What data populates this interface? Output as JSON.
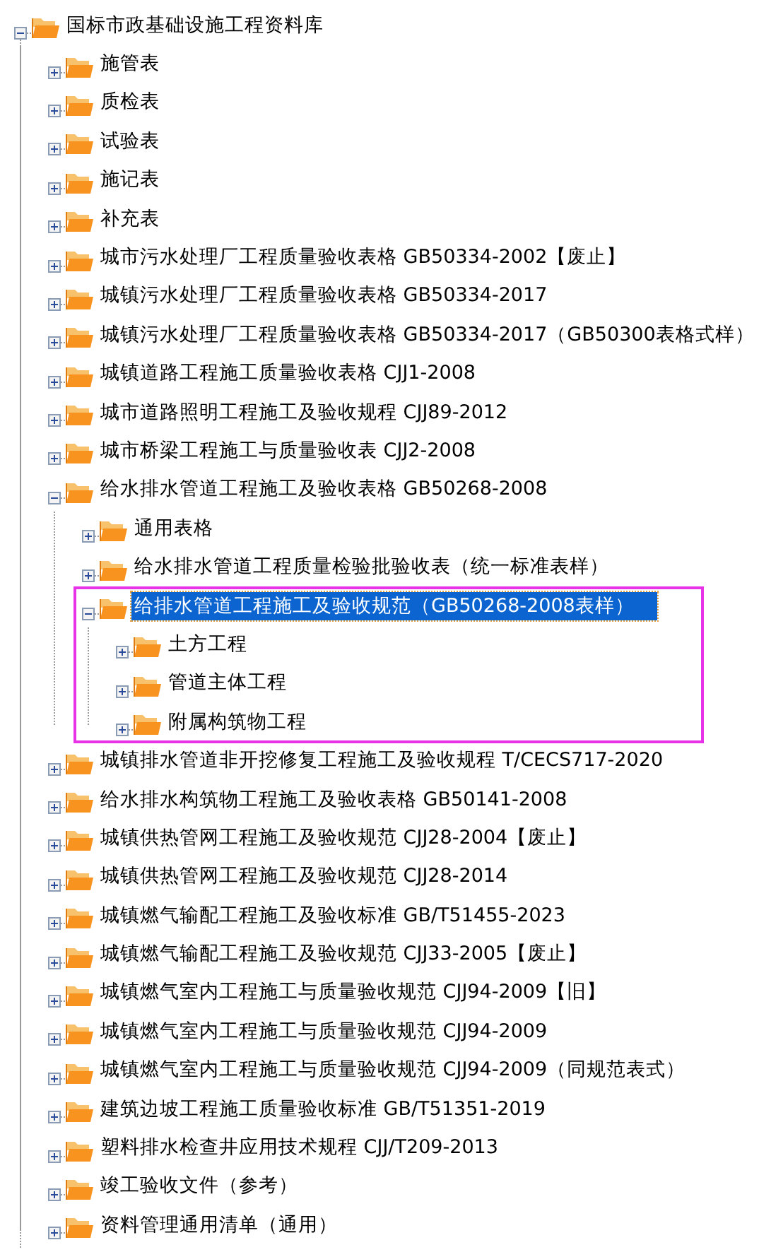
{
  "tree": [
    {
      "label": "国标市政基础设施工程资料库",
      "expanded": true,
      "selected": false,
      "highlighted": false,
      "children": [
        {
          "label": "施管表",
          "expanded": false,
          "selected": false,
          "highlighted": false
        },
        {
          "label": "质检表",
          "expanded": false,
          "selected": false,
          "highlighted": false
        },
        {
          "label": "试验表",
          "expanded": false,
          "selected": false,
          "highlighted": false
        },
        {
          "label": "施记表",
          "expanded": false,
          "selected": false,
          "highlighted": false
        },
        {
          "label": "补充表",
          "expanded": false,
          "selected": false,
          "highlighted": false
        },
        {
          "label": "城市污水处理厂工程质量验收表格 GB50334-2002【废止】",
          "expanded": false,
          "selected": false,
          "highlighted": false
        },
        {
          "label": "城镇污水处理厂工程质量验收表格 GB50334-2017",
          "expanded": false,
          "selected": false,
          "highlighted": false
        },
        {
          "label": "城镇污水处理厂工程质量验收表格 GB50334-2017（GB50300表格式样）",
          "expanded": false,
          "selected": false,
          "highlighted": false
        },
        {
          "label": "城镇道路工程施工质量验收表格 CJJ1-2008",
          "expanded": false,
          "selected": false,
          "highlighted": false
        },
        {
          "label": "城市道路照明工程施工及验收规程 CJJ89-2012",
          "expanded": false,
          "selected": false,
          "highlighted": false
        },
        {
          "label": "城市桥梁工程施工与质量验收表 CJJ2-2008",
          "expanded": false,
          "selected": false,
          "highlighted": false
        },
        {
          "label": "给水排水管道工程施工及验收表格 GB50268-2008",
          "expanded": true,
          "selected": false,
          "highlighted": false,
          "children": [
            {
              "label": "通用表格",
              "expanded": false,
              "selected": false,
              "highlighted": false
            },
            {
              "label": "给水排水管道工程质量检验批验收表（统一标准表样）",
              "expanded": false,
              "selected": false,
              "highlighted": false
            },
            {
              "label": "给排水管道工程施工及验收规范（GB50268-2008表样）",
              "expanded": true,
              "selected": true,
              "highlighted": true,
              "children": [
                {
                  "label": "土方工程",
                  "expanded": false,
                  "selected": false,
                  "highlighted": false
                },
                {
                  "label": "管道主体工程",
                  "expanded": false,
                  "selected": false,
                  "highlighted": false
                },
                {
                  "label": "附属构筑物工程",
                  "expanded": false,
                  "selected": false,
                  "highlighted": false
                }
              ]
            }
          ]
        },
        {
          "label": "城镇排水管道非开挖修复工程施工及验收规程 T/CECS717-2020",
          "expanded": false,
          "selected": false,
          "highlighted": false
        },
        {
          "label": "给水排水构筑物工程施工及验收表格 GB50141-2008",
          "expanded": false,
          "selected": false,
          "highlighted": false
        },
        {
          "label": "城镇供热管网工程施工及验收规范 CJJ28-2004【废止】",
          "expanded": false,
          "selected": false,
          "highlighted": false
        },
        {
          "label": "城镇供热管网工程施工及验收规范 CJJ28-2014",
          "expanded": false,
          "selected": false,
          "highlighted": false
        },
        {
          "label": "城镇燃气输配工程施工及验收标准 GB/T51455-2023",
          "expanded": false,
          "selected": false,
          "highlighted": false
        },
        {
          "label": "城镇燃气输配工程施工及验收规范 CJJ33-2005【废止】",
          "expanded": false,
          "selected": false,
          "highlighted": false
        },
        {
          "label": "城镇燃气室内工程施工与质量验收规范 CJJ94-2009【旧】",
          "expanded": false,
          "selected": false,
          "highlighted": false
        },
        {
          "label": "城镇燃气室内工程施工与质量验收规范 CJJ94-2009",
          "expanded": false,
          "selected": false,
          "highlighted": false
        },
        {
          "label": "城镇燃气室内工程施工与质量验收规范 CJJ94-2009（同规范表式）",
          "expanded": false,
          "selected": false,
          "highlighted": false
        },
        {
          "label": "建筑边坡工程施工质量验收标准 GB/T51351-2019",
          "expanded": false,
          "selected": false,
          "highlighted": false
        },
        {
          "label": "塑料排水检查井应用技术规程 CJJ/T209-2013",
          "expanded": false,
          "selected": false,
          "highlighted": false
        },
        {
          "label": "竣工验收文件（参考）",
          "expanded": false,
          "selected": false,
          "highlighted": false
        },
        {
          "label": "资料管理通用清单（通用）",
          "expanded": false,
          "selected": false,
          "highlighted": false
        }
      ]
    }
  ]
}
